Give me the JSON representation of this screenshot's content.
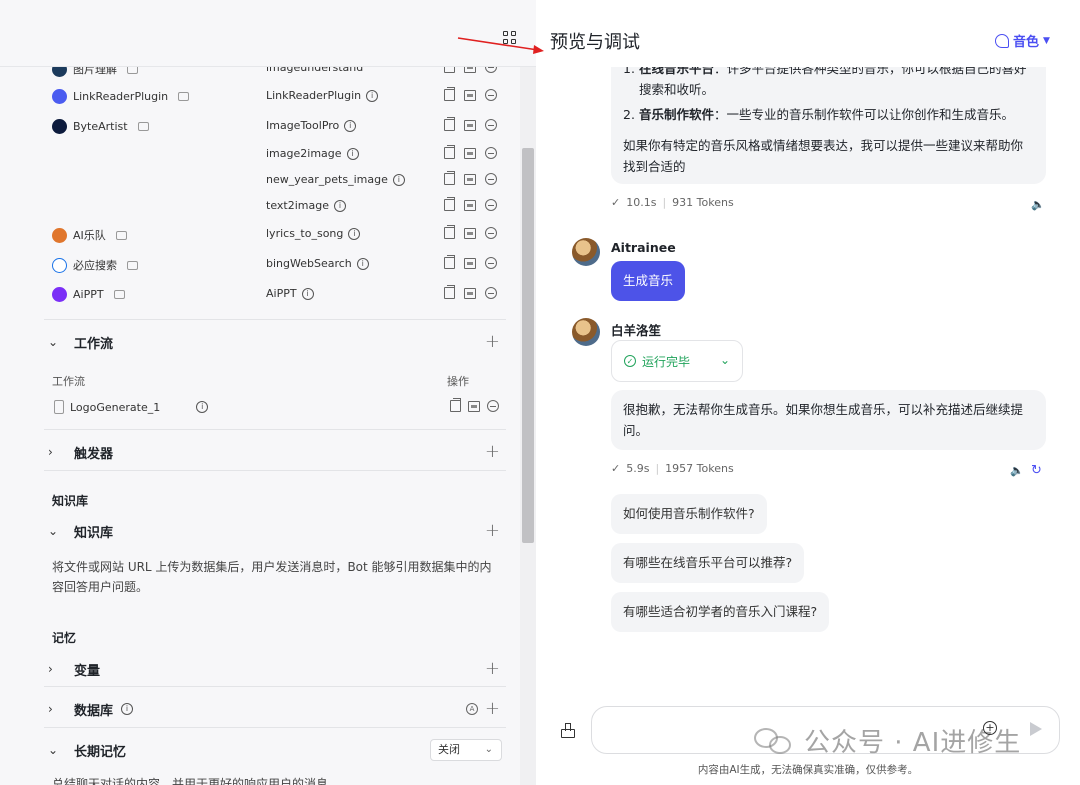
{
  "left": {
    "plugins": [
      {
        "name": "图片理解",
        "tool": "imageunderstand",
        "logo_color": "#1b3a5c"
      },
      {
        "name": "LinkReaderPlugin",
        "tool": "LinkReaderPlugin",
        "logo_color": "#4b5cf0"
      },
      {
        "name": "ByteArtist",
        "tool": "ImageToolPro",
        "logo_color": "#0d1b3d"
      },
      {
        "name": "",
        "tool": "image2image",
        "logo_color": ""
      },
      {
        "name": "",
        "tool": "new_year_pets_image",
        "logo_color": ""
      },
      {
        "name": "",
        "tool": "text2image",
        "logo_color": ""
      },
      {
        "name": "AI乐队",
        "tool": "lyrics_to_song",
        "logo_color": "#e0762d"
      },
      {
        "name": "必应搜索",
        "tool": "bingWebSearch",
        "logo_color": "#1a73e8"
      },
      {
        "name": "AiPPT",
        "tool": "AiPPT",
        "logo_color": "#7b2ff7"
      }
    ],
    "workflow_section": {
      "title": "工作流",
      "col_workflow": "工作流",
      "col_ops": "操作",
      "item": "LogoGenerate_1"
    },
    "trigger_section": {
      "title": "触发器"
    },
    "knowledge_group": "知识库",
    "knowledge_section": {
      "title": "知识库",
      "description": "将文件或网站 URL 上传为数据集后，用户发送消息时，Bot 能够引用数据集中的内容回答用户问题。"
    },
    "memory_group": "记忆",
    "variables_section": {
      "title": "变量"
    },
    "database_section": {
      "title": "数据库"
    },
    "long_memory_section": {
      "title": "长期记忆",
      "select_value": "关闭"
    },
    "long_memory_desc": "总结聊天对话的内容，并用于更好的响应用户的消息。"
  },
  "right": {
    "title": "预览与调试",
    "voice_label": "音色",
    "bot_msg1": {
      "list_item1_title": "在线音乐平台",
      "list_item1_text": "：许多平台提供各种类型的音乐，你可以根据自己的喜好搜索和收听。",
      "list_item2_title": "音乐制作软件",
      "list_item2_text": "：一些专业的音乐制作软件可以让你创作和生成音乐。",
      "closing": "如果你有特定的音乐风格或情绪想要表达，我可以提供一些建议来帮助你找到合适的",
      "time": "10.1s",
      "tokens": "931 Tokens"
    },
    "user": {
      "name": "Aitrainee",
      "message": "生成音乐"
    },
    "bot": {
      "name": "白羊洛笙",
      "status": "运行完毕",
      "reply": "很抱歉，无法帮你生成音乐。如果你想生成音乐，可以补充描述后继续提问。",
      "time": "5.9s",
      "tokens": "1957 Tokens"
    },
    "suggestions": [
      "如何使用音乐制作软件?",
      "有哪些在线音乐平台可以推荐?",
      "有哪些适合初学者的音乐入门课程?"
    ],
    "disclaimer": "内容由AI生成，无法确保真实准确，仅供参考。",
    "watermark": "公众号 · AI进修生"
  },
  "colors": {
    "accent": "#4d53e8",
    "success": "#21a35b",
    "annotation_arrow": "#e02020"
  }
}
